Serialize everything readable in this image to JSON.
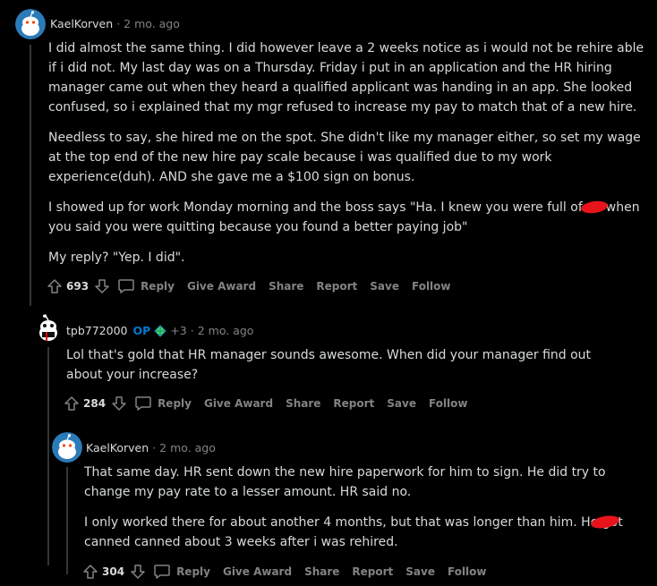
{
  "comments": [
    {
      "username": "KaelKorven",
      "time": "2 mo. ago",
      "paragraphs": [
        "I did almost the same thing. I did however leave a 2 weeks notice as i would not be rehire able if i did not. My last day was on a Thursday. Friday i put in an application and the HR hiring manager came out when they heard a qualified applicant was handing in an app. She looked confused, so i explained that my mgr refused to increase my pay to match that of a new hire.",
        "Needless to say, she hired me on the spot. She didn't like my manager either, so set my wage at the top end of the new hire pay scale because i was qualified due to my work experience(duh). AND she gave me a $100 sign on bonus."
      ],
      "p3_before": "I showed up for work Monday morning and the boss says \"Ha. I knew you were full of",
      "p3_after": "when you said you were quitting because you found a better paying job\"",
      "p4": "My reply? \"Yep. I did\".",
      "score": "693"
    },
    {
      "username": "tpb772000",
      "op_badge": "OP",
      "flair": "+3",
      "time": "2 mo. ago",
      "text": "Lol that's gold that HR manager sounds awesome. When did your manager find out about your increase?",
      "score": "284"
    },
    {
      "username": "KaelKorven",
      "time": "2 mo. ago",
      "p1": "That same day. HR sent down the new hire paperwork for him to sign. He did try to change my pay rate to a lesser amount. HR said no.",
      "p2_line1": "I only worked there for about another 4 months, but that was longer than him. He got",
      "p2_line2": "canned canned about 3 weeks after i was rehired.",
      "score": "304"
    }
  ],
  "actions": {
    "reply": "Reply",
    "give_award": "Give Award",
    "share": "Share",
    "report": "Report",
    "save": "Save",
    "follow": "Follow"
  },
  "colors": {
    "background": "#000000",
    "text": "#d7dadc",
    "meta": "#818384",
    "op": "#0079d3",
    "avatar_bg": "#2b7bb9",
    "redaction": "#e8141b"
  }
}
